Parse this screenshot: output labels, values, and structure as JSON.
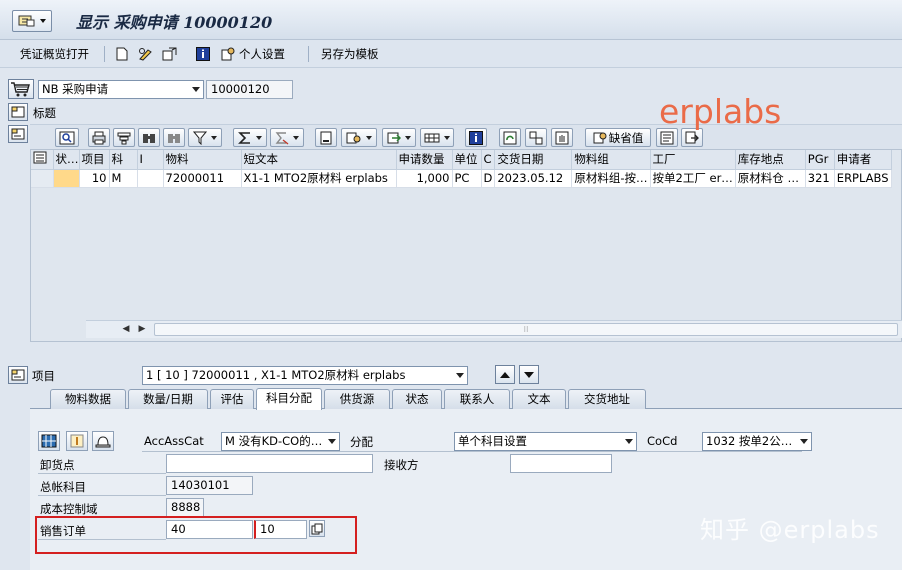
{
  "title": "显示 采购申请 10000120",
  "toolbar": {
    "document_overview": "凭证概览打开",
    "personal_settings": "个人设置",
    "save_as_template": "另存为模板"
  },
  "document": {
    "type": "NB 采购申请",
    "number": "10000120"
  },
  "header_label": "标题",
  "grid_toolbar": {
    "default_values": "缺省值"
  },
  "table": {
    "columns": [
      "状…",
      "项目",
      "科",
      "I",
      "物料",
      "短文本",
      "申请数量",
      "单位",
      "C",
      "交货日期",
      "物料组",
      "工厂",
      "库存地点",
      "PGr",
      "申请者"
    ],
    "rows": [
      [
        "",
        "10",
        "M",
        "",
        "72000011",
        "X1-1 MTO2原材料 erplabs",
        "1,000",
        "PC",
        "D",
        "2023.05.12",
        "原材料组-按…",
        "按单2工厂 er…",
        "原材料仓 …",
        "321",
        "ERPLABS"
      ]
    ]
  },
  "watermark": "erplabs",
  "watermark_bottom": "知乎 @erplabs",
  "item": {
    "label": "项目",
    "selected": "1 [ 10 ] 72000011 , X1-1 MTO2原材料 erplabs"
  },
  "tabs": [
    "物料数据",
    "数量/日期",
    "评估",
    "科目分配",
    "供货源",
    "状态",
    "联系人",
    "文本",
    "交货地址"
  ],
  "active_tab": "科目分配",
  "account_assignment": {
    "acc_ass_cat_label": "AccAssCat",
    "acc_ass_cat_value": "M 没有KD-CO的…",
    "distribution_label": "分配",
    "distribution_value": "单个科目设置",
    "cocd_label": "CoCd",
    "cocd_value": "1032 按单2公…",
    "unloading_point_label": "卸货点",
    "unloading_point_value": "",
    "recipient_label": "接收方",
    "recipient_value": "",
    "gl_account_label": "总帐科目",
    "gl_account_value": "14030101",
    "co_area_label": "成本控制域",
    "co_area_value": "8888",
    "sales_order_label": "销售订单",
    "sales_order_value": "40",
    "sales_order_item_value": "10"
  }
}
